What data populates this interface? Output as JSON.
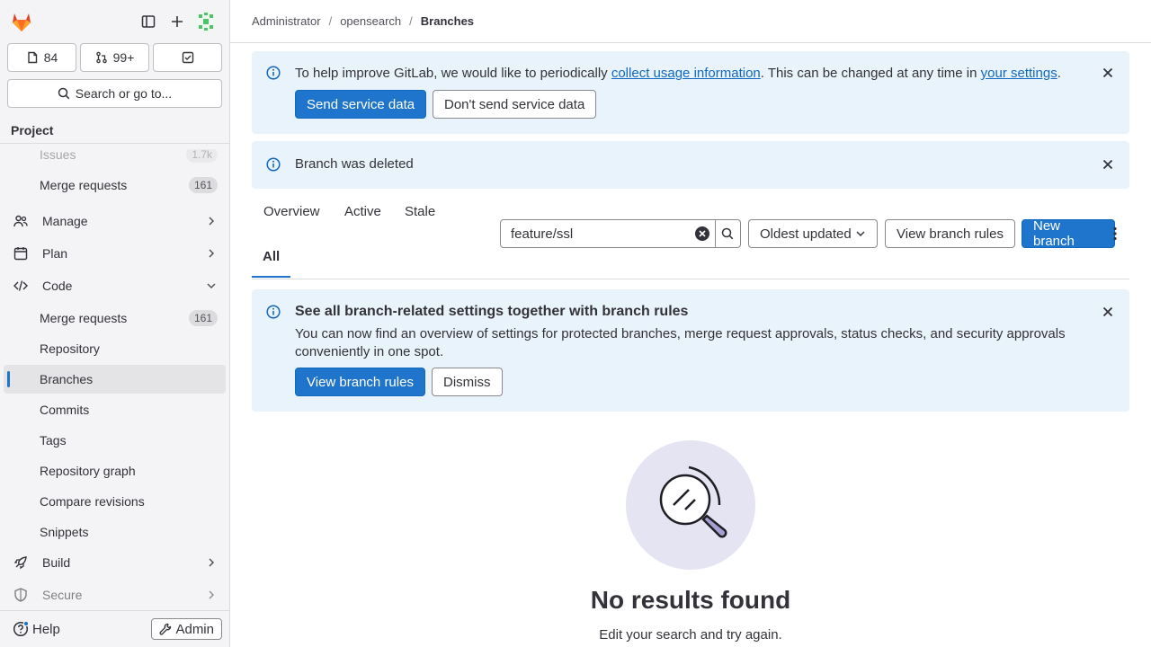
{
  "sidebar": {
    "issues_count": "84",
    "mr_count": "99+",
    "search_label": "Search or go to...",
    "section_title": "Project",
    "items": [
      {
        "label": "Issues",
        "badge": "1.7k"
      },
      {
        "label": "Merge requests",
        "badge": "161"
      },
      {
        "label": "Manage"
      },
      {
        "label": "Plan"
      },
      {
        "label": "Code"
      },
      {
        "label": "Merge requests",
        "badge": "161"
      },
      {
        "label": "Repository"
      },
      {
        "label": "Branches"
      },
      {
        "label": "Commits"
      },
      {
        "label": "Tags"
      },
      {
        "label": "Repository graph"
      },
      {
        "label": "Compare revisions"
      },
      {
        "label": "Snippets"
      },
      {
        "label": "Build"
      },
      {
        "label": "Secure"
      }
    ],
    "help_label": "Help",
    "admin_label": "Admin"
  },
  "breadcrumb": [
    "Administrator",
    "opensearch",
    "Branches"
  ],
  "usage_alert": {
    "text_before": "To help improve GitLab, we would like to periodically ",
    "link1": "collect usage information",
    "text_mid": ". This can be changed at any time in ",
    "link2": "your settings",
    "text_after": ".",
    "send_label": "Send service data",
    "dont_send_label": "Don't send service data"
  },
  "deleted_alert": {
    "text": "Branch was deleted"
  },
  "tabs": [
    "Overview",
    "Active",
    "Stale",
    "All"
  ],
  "search": {
    "value": "feature/ssl"
  },
  "sort_label": "Oldest updated",
  "view_rules_label": "View branch rules",
  "new_branch_label": "New branch",
  "rules_alert": {
    "title": "See all branch-related settings together with branch rules",
    "body": "You can now find an overview of settings for protected branches, merge request approvals, status checks, and security approvals conveniently in one spot.",
    "view_label": "View branch rules",
    "dismiss_label": "Dismiss"
  },
  "empty_state": {
    "title": "No results found",
    "body": "Edit your search and try again."
  },
  "colors": {
    "primary": "#1f75cb",
    "alert_bg": "#e9f3fc",
    "sidebar_bg": "#f4f4f6"
  }
}
